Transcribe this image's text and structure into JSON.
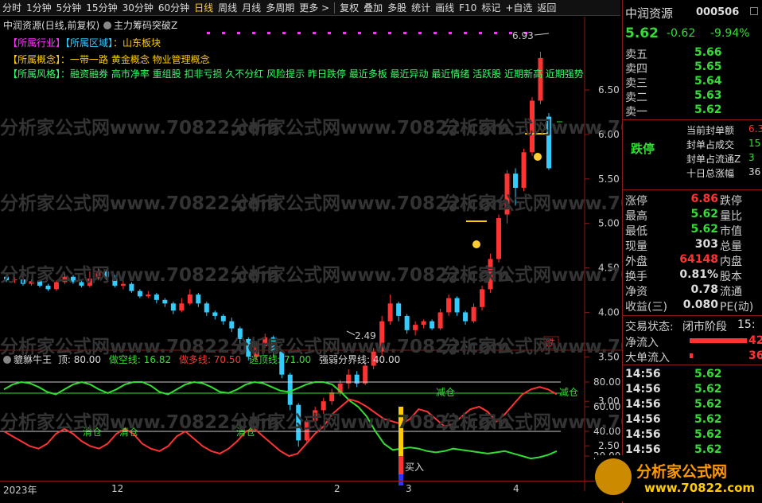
{
  "toolbar": {
    "items": [
      "分时",
      "1分钟",
      "5分钟",
      "15分钟",
      "30分钟",
      "60分钟",
      "日线",
      "周线",
      "月线",
      "多周期",
      "更多 >"
    ],
    "right_items": [
      "复权",
      "叠加",
      "多股",
      "统计",
      "画线",
      "F10",
      "标记",
      "+自选",
      "返回"
    ],
    "active": "日线"
  },
  "main_header": {
    "title": "中润资源(日线,前复权)",
    "indicator": "主力筹码突破Z",
    "dropdown_icon": "chevron-down-icon"
  },
  "info": {
    "industry_label": "【所属行业】",
    "region_label": "【所属区域】",
    "region_value": "：山东板块",
    "concept_label": "【所属概念】",
    "concept_value": "：一带一路 黄金概念 物业管理概念",
    "style_label": "【所属风格】",
    "style_value": "：融资融券 高市净率 重组股 扣非亏损 久不分红 风险提示 昨日跌停 最近多板 最近异动 最近情绪 活跃股 近期新高 近期强势"
  },
  "watermark": "分析家公式网www.70822.com",
  "price_axis": [
    "6.50",
    "6.00",
    "5.50",
    "5.00",
    "4.50",
    "4.00",
    "3.50",
    "3.00",
    "2.50"
  ],
  "marks": {
    "high": "6.93",
    "low": "2.49",
    "limit": "跌"
  },
  "sub_header": {
    "name": "貔貅牛王",
    "top_label": "顶: 80.00",
    "short_label": "做空线: 16.82",
    "long_label": "做多线: 70.50",
    "escape_label": "逃顶线: 71.00",
    "divider_label": "强弱分界线: 40.00"
  },
  "sub_axis": [
    "80.00",
    "60.00",
    "40.00",
    "20.00"
  ],
  "sub_labels": {
    "clear": "清仓",
    "reduce": "减仓",
    "buy": "买入"
  },
  "x_axis": [
    "2023年",
    "12",
    "2",
    "3",
    "4"
  ],
  "stock": {
    "name": "中润资源",
    "code": "000506",
    "price": "5.62",
    "change": "-0.62",
    "pct": "-9.94%"
  },
  "orderbook": [
    {
      "label": "卖五",
      "price": "5.66"
    },
    {
      "label": "卖四",
      "price": "5.65"
    },
    {
      "label": "卖三",
      "price": "5.64"
    },
    {
      "label": "卖二",
      "price": "5.63"
    },
    {
      "label": "卖一",
      "price": "5.62"
    }
  ],
  "limit": {
    "status": "跌停",
    "seal_amount_label": "当前封单额",
    "seal_amount": "6.3",
    "seal_deal_label": "封单占成交",
    "seal_deal": "15",
    "seal_float_label": "封单占流通Z",
    "seal_float": "3",
    "ten_day_label": "十日总涨幅",
    "ten_day": "36"
  },
  "stats": [
    {
      "l1": "涨停",
      "v1": "6.86",
      "c1": "up",
      "l2": "跌停",
      "v2": ""
    },
    {
      "l1": "最高",
      "v1": "5.62",
      "c1": "dn",
      "l2": "量比",
      "v2": ""
    },
    {
      "l1": "最低",
      "v1": "5.62",
      "c1": "dn",
      "l2": "市值",
      "v2": ""
    },
    {
      "l1": "现量",
      "v1": "303",
      "c1": "wh",
      "l2": "总量",
      "v2": ""
    },
    {
      "l1": "外盘",
      "v1": "64148",
      "c1": "up",
      "l2": "内盘",
      "v2": ""
    },
    {
      "l1": "换手",
      "v1": "0.81%",
      "c1": "wh",
      "l2": "股本",
      "v2": ""
    },
    {
      "l1": "净资",
      "v1": "0.78",
      "c1": "wh",
      "l2": "流通",
      "v2": ""
    },
    {
      "l1": "收益(三)",
      "v1": "0.080",
      "c1": "wh",
      "l2": "PE(动)",
      "v2": ""
    }
  ],
  "trade_state": {
    "label": "交易状态:",
    "value": "闭市阶段",
    "time": "15:"
  },
  "flow": [
    {
      "label": "净流入",
      "value": "42"
    },
    {
      "label": "大单流入",
      "value": "36"
    }
  ],
  "ticks": [
    {
      "time": "14:56",
      "price": "5.62"
    },
    {
      "time": "14:56",
      "price": "5.62"
    },
    {
      "time": "14:56",
      "price": "5.62"
    },
    {
      "time": "14:56",
      "price": "5.62"
    },
    {
      "time": "14:56",
      "price": "5.62"
    },
    {
      "time": "14:56",
      "price": "5.62"
    },
    {
      "time": "14:56",
      "price": "5.62"
    }
  ],
  "logo": {
    "name": "分析家公式网",
    "url": "www.70822.com"
  }
}
